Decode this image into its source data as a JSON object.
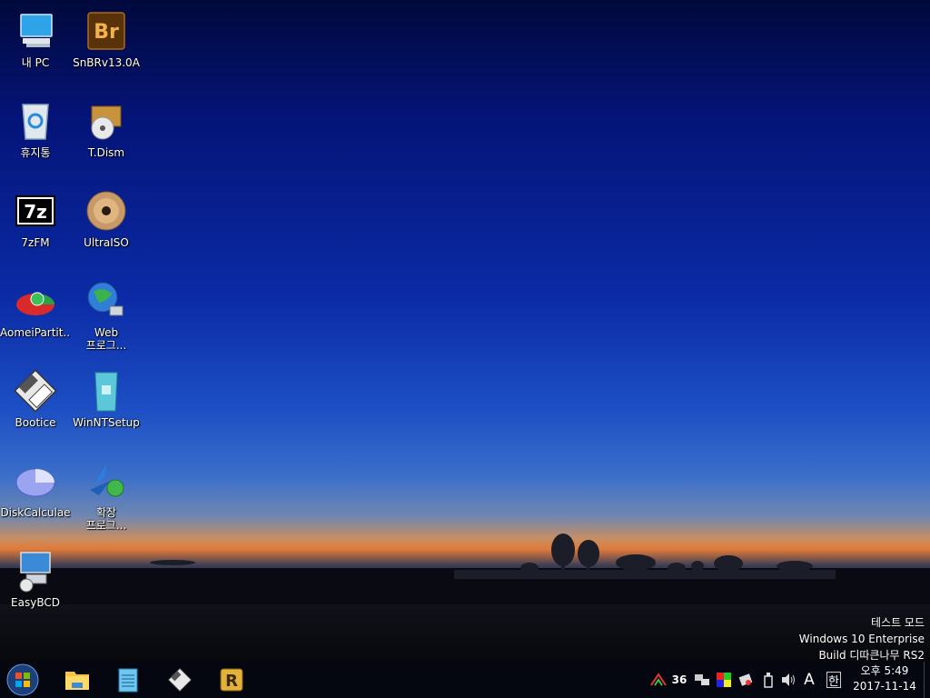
{
  "desktop": {
    "icons": [
      {
        "label": "내 PC"
      },
      {
        "label": "SnBRv13.0A"
      },
      {
        "label": "휴지통"
      },
      {
        "label": "T.Dism"
      },
      {
        "label": "7zFM"
      },
      {
        "label": "UltraISO"
      },
      {
        "label": "AomeiPartit..."
      },
      {
        "label": "Web\n프로그..."
      },
      {
        "label": "Bootice"
      },
      {
        "label": "WinNTSetup"
      },
      {
        "label": "DiskCalculae"
      },
      {
        "label": "확장\n프로그..."
      },
      {
        "label": "EasyBCD"
      }
    ]
  },
  "watermark": {
    "line1": "테스트 모드",
    "line2": "Windows 10 Enterprise",
    "line3": "Build 디따큰나무 RS2"
  },
  "taskbar": {
    "start_icon": "windows-orb-icon",
    "pinned": [
      "file-explorer-icon",
      "notepad-icon",
      "bootice-icon",
      "rufus-icon"
    ],
    "tray": {
      "badge_number": "36",
      "ime_letter": "A",
      "ime_lang": "한"
    },
    "clock": {
      "time": "오후 5:49",
      "date": "2017-11-14"
    }
  },
  "colors": {
    "sky_top": "#01093b",
    "sky_mid": "#0b2ba6",
    "sunset": "#e07a3a",
    "taskbar": "#04060e"
  }
}
